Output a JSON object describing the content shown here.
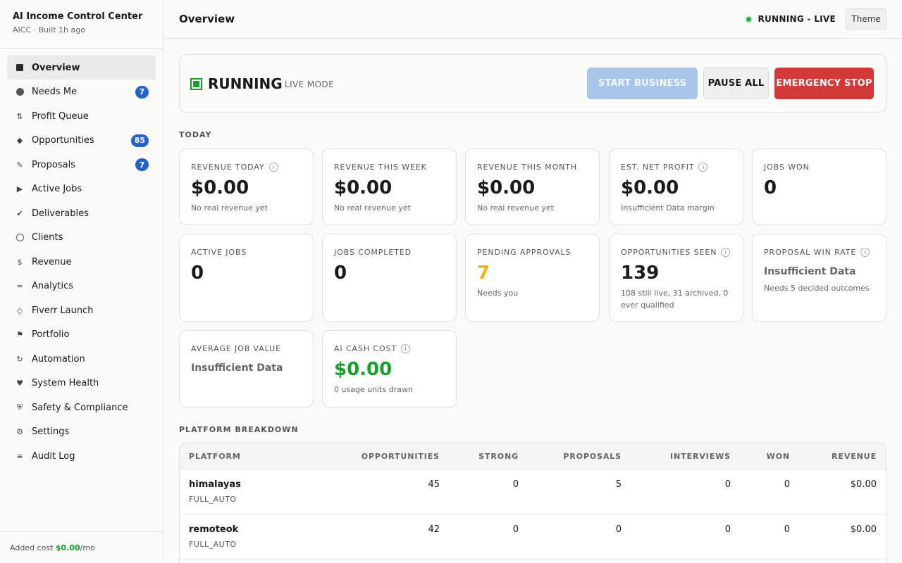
{
  "sidebar": {
    "title": "AI Income Control Center",
    "subtitle": "AICC · Built 1h ago",
    "items": [
      {
        "label": "Overview",
        "icon": "square-icon",
        "active": true
      },
      {
        "label": "Needs Me",
        "icon": "circle-icon",
        "badge": "7"
      },
      {
        "label": "Profit Queue",
        "icon": "arrows-icon"
      },
      {
        "label": "Opportunities",
        "icon": "diamond-icon",
        "badge": "85"
      },
      {
        "label": "Proposals",
        "icon": "pencil-icon",
        "badge": "7"
      },
      {
        "label": "Active Jobs",
        "icon": "play-icon"
      },
      {
        "label": "Deliverables",
        "icon": "check-icon"
      },
      {
        "label": "Clients",
        "icon": "circle-outline-icon"
      },
      {
        "label": "Revenue",
        "icon": "dollar-icon"
      },
      {
        "label": "Analytics",
        "icon": "wave-icon"
      },
      {
        "label": "Fiverr Launch",
        "icon": "diamond-outline-icon"
      },
      {
        "label": "Portfolio",
        "icon": "flag-icon"
      },
      {
        "label": "Automation",
        "icon": "refresh-icon"
      },
      {
        "label": "System Health",
        "icon": "heart-icon"
      },
      {
        "label": "Safety & Compliance",
        "icon": "shield-icon"
      },
      {
        "label": "Settings",
        "icon": "gear-icon"
      },
      {
        "label": "Audit Log",
        "icon": "list-icon"
      }
    ],
    "footer_prefix": "Added cost ",
    "footer_amount": "$0.00",
    "footer_suffix": "/mo"
  },
  "header": {
    "title": "Overview",
    "status": "RUNNING - LIVE",
    "theme_label": "Theme"
  },
  "control": {
    "state": "RUNNING",
    "mode": "LIVE MODE",
    "start_label": "START BUSINESS",
    "pause_label": "PAUSE ALL",
    "stop_label": "EMERGENCY STOP"
  },
  "today_label": "TODAY",
  "stats": [
    {
      "label": "REVENUE TODAY",
      "info": true,
      "value": "$0.00",
      "sub": "No real revenue yet"
    },
    {
      "label": "REVENUE THIS WEEK",
      "value": "$0.00",
      "sub": "No real revenue yet"
    },
    {
      "label": "REVENUE THIS MONTH",
      "value": "$0.00",
      "sub": "No real revenue yet"
    },
    {
      "label": "EST. NET PROFIT",
      "info": true,
      "value": "$0.00",
      "sub": "Insufficient Data margin"
    },
    {
      "label": "JOBS WON",
      "value": "0",
      "sub": ""
    },
    {
      "label": "ACTIVE JOBS",
      "value": "0",
      "sub": ""
    },
    {
      "label": "JOBS COMPLETED",
      "value": "0",
      "sub": ""
    },
    {
      "label": "PENDING APPROVALS",
      "value": "7",
      "sub": "Needs you"
    },
    {
      "label": "OPPORTUNITIES SEEN",
      "info": true,
      "value": "139",
      "sub": "108 still live, 31 archived, 0 ever qualified"
    },
    {
      "label": "PROPOSAL WIN RATE",
      "info": true,
      "value": "Insufficient Data",
      "sub": "Needs 5 decided outcomes"
    },
    {
      "label": "AVERAGE JOB VALUE",
      "value": "Insufficient Data",
      "sub": ""
    },
    {
      "label": "AI CASH COST",
      "info": true,
      "value": "$0.00",
      "sub": "0 usage units drawn"
    }
  ],
  "platform_label": "PLATFORM BREAKDOWN",
  "table": {
    "headers": [
      "PLATFORM",
      "OPPORTUNITIES",
      "STRONG",
      "PROPOSALS",
      "INTERVIEWS",
      "WON",
      "REVENUE"
    ],
    "rows": [
      {
        "name": "himalayas",
        "mode": "FULL_AUTO",
        "opportunities": "45",
        "strong": "0",
        "proposals": "5",
        "interviews": "0",
        "won": "0",
        "revenue": "$0.00"
      },
      {
        "name": "remoteok",
        "mode": "FULL_AUTO",
        "opportunities": "42",
        "strong": "0",
        "proposals": "0",
        "interviews": "0",
        "won": "0",
        "revenue": "$0.00"
      }
    ]
  },
  "colors": {
    "accent_blue": "#2563c9",
    "running_green": "#17a02c",
    "stop_red": "#d23a37",
    "pending_orange": "#efb020"
  }
}
